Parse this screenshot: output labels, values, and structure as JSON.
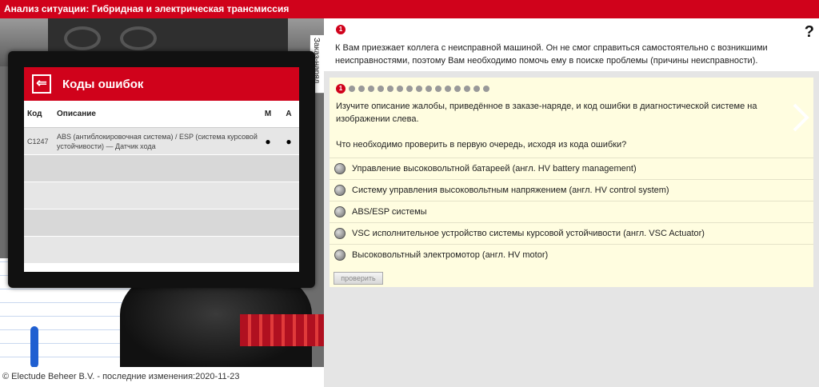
{
  "window": {
    "title": "Анализ ситуации: Гибридная и электрическая трансмиссия"
  },
  "order_tab": {
    "label": "Заказ-наряд"
  },
  "tablet": {
    "title": "Коды ошибок",
    "columns": {
      "code": "Код",
      "description": "Описание",
      "m": "М",
      "a": "А"
    },
    "rows": [
      {
        "code": "C1247",
        "description": "ABS (антиблокировочная система) / ESP (система курсовой устойчивости) — Датчик хода",
        "m": "●",
        "a": "●"
      },
      {
        "code": "",
        "description": "",
        "m": "",
        "a": ""
      },
      {
        "code": "",
        "description": "",
        "m": "",
        "a": ""
      },
      {
        "code": "",
        "description": "",
        "m": "",
        "a": ""
      },
      {
        "code": "",
        "description": "",
        "m": "",
        "a": ""
      }
    ]
  },
  "footer": {
    "copyright": "© Electude Beheer B.V. - последние изменения:2020-11-23"
  },
  "intro": {
    "step": "1",
    "text": "К Вам приезжает коллега с неисправной машиной. Он не смог справиться самостоятельно с возникшими неисправностями, поэтому Вам необходимо помочь ему в поиске проблемы (причины неисправности).",
    "help": "?"
  },
  "question": {
    "step": "1",
    "progress_total": 16,
    "text": "Изучите описание жалобы, приведённое в заказе-наряде, и код ошибки в диагностической системе на изображении слева.",
    "prompt": "Что необходимо проверить в первую очередь, исходя из кода ошибки?",
    "options": [
      "Управление высоковольтной батареей (англ. HV battery management)",
      "Систему управления высоковольтным напряжением (англ. HV control system)",
      "ABS/ESP системы",
      "VSC исполнительное устройство системы курсовой устойчивости (англ. VSC Actuator)",
      "Высоковольтный электромотор (англ. HV motor)"
    ],
    "check_label": "проверить"
  }
}
